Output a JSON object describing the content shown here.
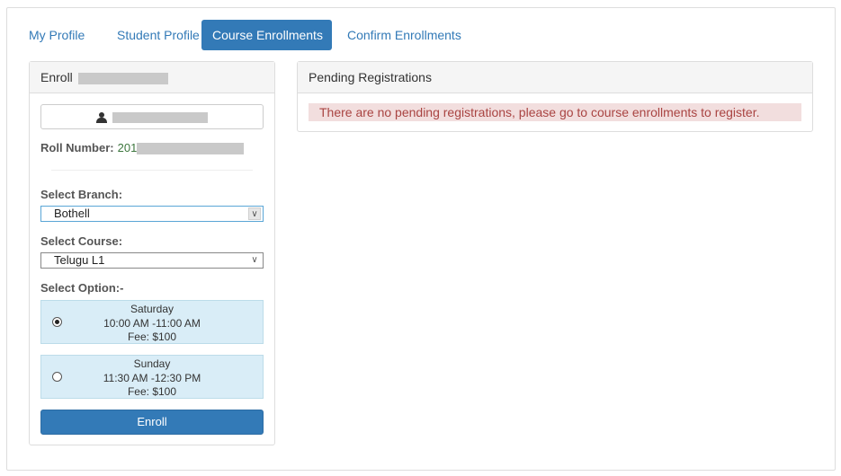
{
  "tabs": [
    {
      "label": "My Profile",
      "active": false
    },
    {
      "label": "Student Profile",
      "active": false
    },
    {
      "label": "Course Enrollments",
      "active": true
    },
    {
      "label": "Confirm Enrollments",
      "active": false
    }
  ],
  "enroll_panel": {
    "heading": "Enroll",
    "roll_label": "Roll Number:",
    "roll_prefix": "201",
    "branch_label": "Select Branch:",
    "branch_value": "Bothell",
    "course_label": "Select Course:",
    "course_value": "Telugu L1",
    "option_label": "Select Option:-",
    "options": [
      {
        "day": "Saturday",
        "time": "10:00 AM -11:00 AM",
        "fee": "Fee: $100",
        "selected": true
      },
      {
        "day": "Sunday",
        "time": "11:30 AM -12:30 PM",
        "fee": "Fee: $100",
        "selected": false
      }
    ],
    "enroll_button": "Enroll"
  },
  "pending_panel": {
    "heading": "Pending Registrations",
    "message": "There are no pending registrations, please go to course enrollments to register."
  },
  "colors": {
    "primary": "#337ab7",
    "option_bg": "#d9edf7",
    "alert_bg": "#f2dede",
    "alert_text": "#a94442",
    "roll_number": "#3c763d"
  },
  "icons": {
    "user": "user-icon",
    "dropdown": "chevron-down-icon"
  }
}
